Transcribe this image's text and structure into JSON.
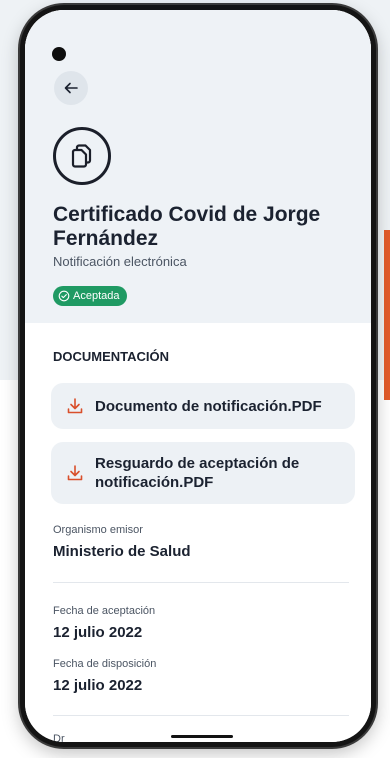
{
  "header": {
    "title": "Certificado Covid de Jorge Fernández",
    "subtitle": "Notificación electrónica",
    "status_badge": "Aceptada"
  },
  "documentation": {
    "section_title": "DOCUMENTACIÓN",
    "files": [
      {
        "label": "Documento de notificación.PDF"
      },
      {
        "label": "Resguardo de aceptación de notificación.PDF"
      }
    ]
  },
  "fields": {
    "issuer_label": "Organismo emisor",
    "issuer_value": "Ministerio de Salud",
    "acceptance_label": "Fecha de aceptación",
    "acceptance_value": "12 julio 2022",
    "disposition_label": "Fecha de disposición",
    "disposition_value": "12 julio 2022",
    "partial_label": "Dr"
  },
  "colors": {
    "header_bg": "#eef2f6",
    "badge_green": "#1f9a63",
    "download_icon": "#d94f2b",
    "text_dark": "#1b2230"
  },
  "icons": {
    "back": "arrow-left-icon",
    "document": "documents-copy-icon",
    "badge": "check-circle-icon",
    "download": "download-icon"
  }
}
